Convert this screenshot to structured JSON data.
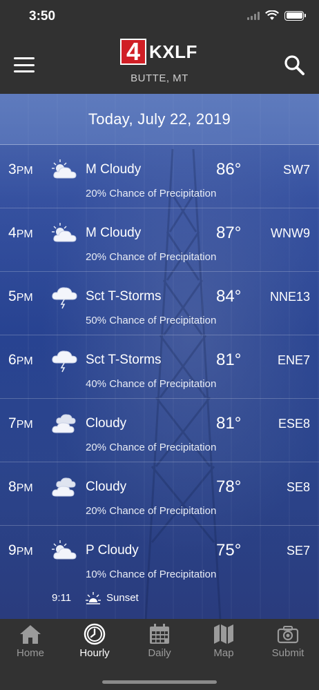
{
  "status_bar": {
    "time": "3:50"
  },
  "header": {
    "logo_number": "4",
    "logo_text": "KXLF",
    "location": "BUTTE, MT"
  },
  "date_bar": {
    "label": "Today, July 22, 2019"
  },
  "forecast": [
    {
      "hour": "3",
      "period": "PM",
      "icon": "partly-cloudy-icon",
      "condition": "M Cloudy",
      "temp": "86°",
      "wind": "SW7",
      "precip": "20% Chance of Precipitation"
    },
    {
      "hour": "4",
      "period": "PM",
      "icon": "partly-cloudy-icon",
      "condition": "M Cloudy",
      "temp": "87°",
      "wind": "WNW9",
      "precip": "20% Chance of Precipitation"
    },
    {
      "hour": "5",
      "period": "PM",
      "icon": "thunderstorm-icon",
      "condition": "Sct T-Storms",
      "temp": "84°",
      "wind": "NNE13",
      "precip": "50% Chance of Precipitation"
    },
    {
      "hour": "6",
      "period": "PM",
      "icon": "thunderstorm-icon",
      "condition": "Sct T-Storms",
      "temp": "81°",
      "wind": "ENE7",
      "precip": "40% Chance of Precipitation"
    },
    {
      "hour": "7",
      "period": "PM",
      "icon": "cloudy-icon",
      "condition": "Cloudy",
      "temp": "81°",
      "wind": "ESE8",
      "precip": "20% Chance of Precipitation"
    },
    {
      "hour": "8",
      "period": "PM",
      "icon": "cloudy-icon",
      "condition": "Cloudy",
      "temp": "78°",
      "wind": "SE8",
      "precip": "20% Chance of Precipitation"
    },
    {
      "hour": "9",
      "period": "PM",
      "icon": "partly-cloudy-icon",
      "condition": "P Cloudy",
      "temp": "75°",
      "wind": "SE7",
      "precip": "10% Chance of Precipitation"
    }
  ],
  "sunset": {
    "time": "9:11",
    "label": "Sunset",
    "icon": "sunset-icon"
  },
  "tabs": [
    {
      "label": "Home",
      "icon": "home-icon",
      "active": false
    },
    {
      "label": "Hourly",
      "icon": "clock-icon",
      "active": true
    },
    {
      "label": "Daily",
      "icon": "calendar-icon",
      "active": false
    },
    {
      "label": "Map",
      "icon": "map-icon",
      "active": false
    },
    {
      "label": "Submit",
      "icon": "camera-icon",
      "active": false
    }
  ],
  "colors": {
    "header_bg": "#313131",
    "logo_red": "#d01f26",
    "sky_blue": "#2d4a9e",
    "tab_inactive": "#9b9b9b",
    "tab_active": "#ffffff"
  }
}
